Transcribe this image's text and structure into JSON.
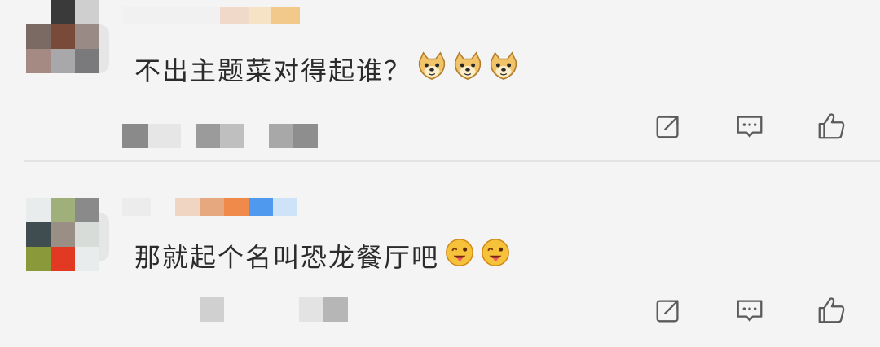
{
  "comments": [
    {
      "text": "不出主题菜对得起谁？",
      "emoji_name": "doge-emoji",
      "emoji_count": 3,
      "avatar_colors": [
        "#111111",
        "#3a3a3a",
        "#cfcfcf",
        "#7b6a63",
        "#7a4a38",
        "#9a8a86",
        "#a58a84",
        "#a8a8aa",
        "#7a7a7d"
      ],
      "name_colors": [
        "#f0d9c8",
        "#f6e3c6",
        "#f2c98a"
      ],
      "meta_colors": [
        "#8a8a8a",
        "#e6e6e6",
        "#9b9b9b",
        "#bfbfbf",
        "#a8a8a8",
        "#8e8e8e"
      ]
    },
    {
      "text": "那就起个名叫恐龙餐厅吧",
      "emoji_name": "tongue-out-emoji",
      "emoji_count": 2,
      "avatar_colors": [
        "#e8ecec",
        "#a0b07a",
        "#8a8a8a",
        "#3f4d50",
        "#9a8f84",
        "#d8dcd8",
        "#8a9a3a",
        "#e23a22",
        "#e8ecec"
      ],
      "name_colors": [
        "#f0d6c2",
        "#e6a87e",
        "#ef8a4a",
        "#4f9aef",
        "#cfe3f8"
      ],
      "meta_colors": [
        "#d0d0d0",
        "#e3e3e3",
        "#b6b6b6",
        "#8f8f8f"
      ]
    }
  ],
  "actions": [
    "share-icon",
    "reply-icon",
    "like-icon"
  ]
}
